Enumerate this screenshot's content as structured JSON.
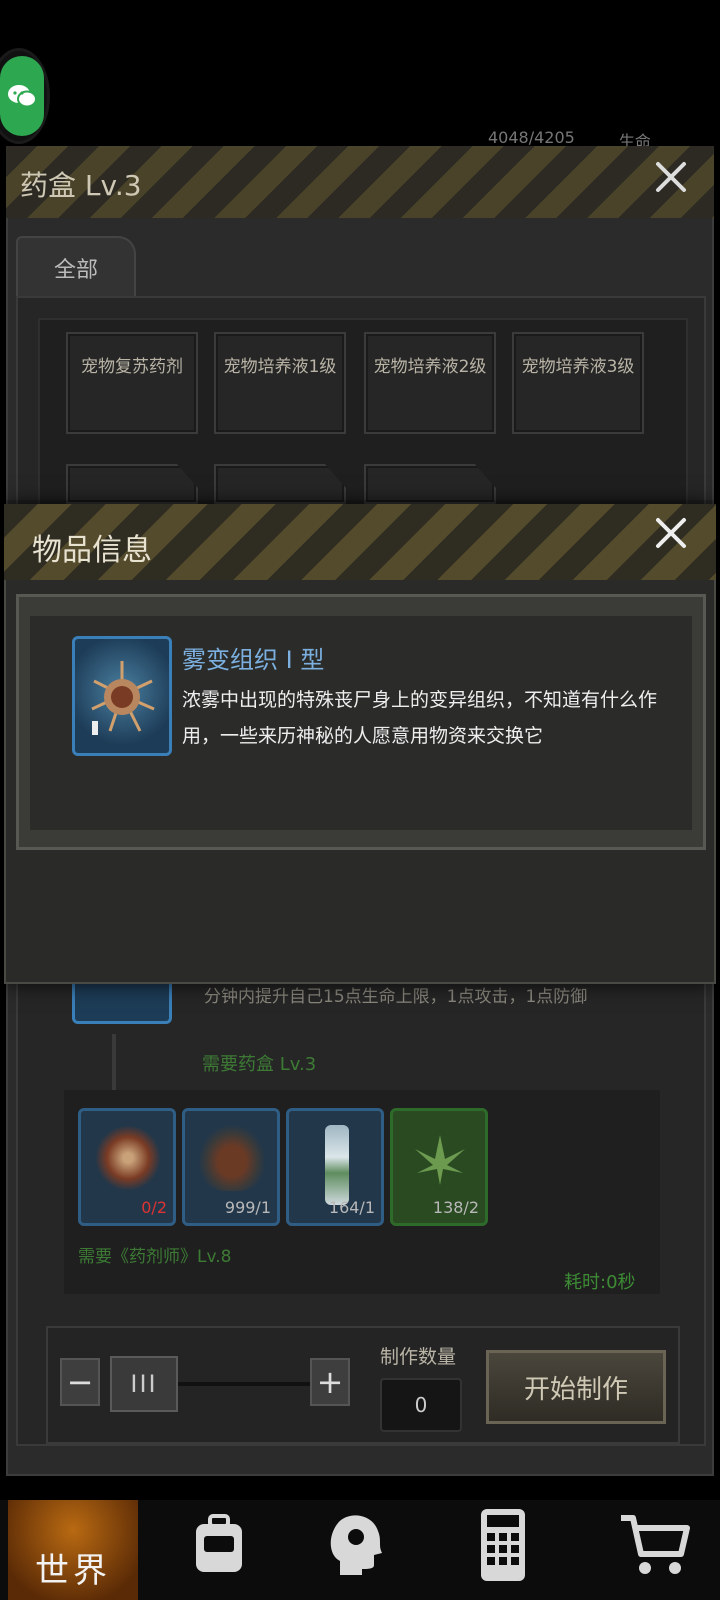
{
  "status": {
    "chat_icon": "wechat-icon",
    "stamina": "4048/4205",
    "life_label": "生命"
  },
  "window": {
    "title": "药盒 Lv.3",
    "close": "×",
    "tab_all": "全部"
  },
  "recipes": [
    {
      "label": "宠物复苏药剂"
    },
    {
      "label": "宠物培养液1级"
    },
    {
      "label": "宠物培养液2级"
    },
    {
      "label": "宠物培养液3级"
    }
  ],
  "dialog": {
    "title": "物品信息",
    "close": "×",
    "item_name": "雾变组织 I 型",
    "item_desc": "浓雾中出现的特殊丧尸身上的变异组织，不知道有什么作用，一些来历神秘的人愿意用物资来交换它",
    "item_icon": "mutant-tissue-icon"
  },
  "detail": {
    "effect_text": "分钟内提升自己15点生命上限，1点攻击，1点防御",
    "need_box": "需要药盒 Lv.3",
    "need_skill": "需要《药剂师》Lv.8",
    "time": "耗时:0秒"
  },
  "materials": [
    {
      "icon": "mutant-tissue-icon",
      "count": "0/2",
      "status": "insufficient"
    },
    {
      "icon": "meat-bowl-icon",
      "count": "999/1",
      "status": "ok"
    },
    {
      "icon": "water-bottle-icon",
      "count": "164/1",
      "status": "ok"
    },
    {
      "icon": "herb-leaf-icon",
      "count": "138/2",
      "status": "ok"
    }
  ],
  "craft": {
    "minus": "−",
    "plus": "+",
    "handle": "III",
    "qty_label": "制作数量",
    "qty_value": "0",
    "start_label": "开始制作"
  },
  "nav": {
    "world": "世界",
    "items": [
      "backpack-icon",
      "skills-head-icon",
      "phone-icon",
      "cart-icon"
    ]
  },
  "colors": {
    "accent_blue": "#3a7fb8",
    "need_green": "#3d7b35",
    "warning_red": "#dd3333",
    "nav_world": "#b96a12"
  }
}
